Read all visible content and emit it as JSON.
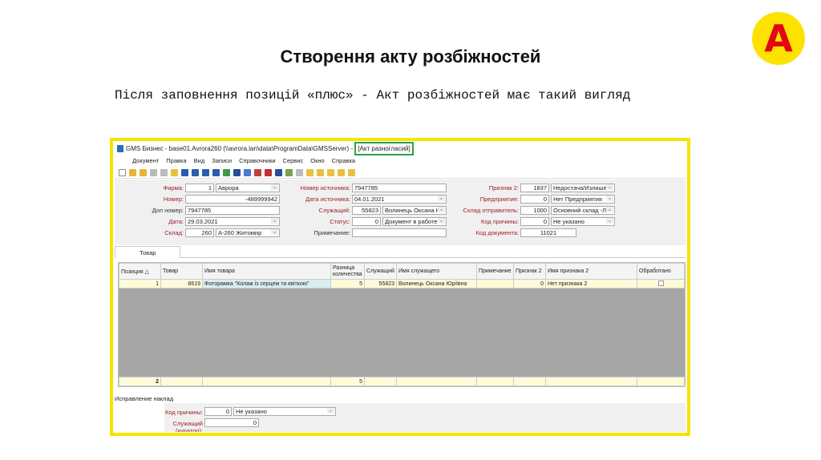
{
  "logo": "A",
  "slide": {
    "title": "Створення акту розбіжностей",
    "description": "Після заповнення позицій «плюс» - Акт розбіжностей має такий вигляд"
  },
  "window": {
    "title": "GMS Бизнес - base01.Avrora260 (\\\\avrora.lan\\data\\ProgramData\\GMSServer)",
    "title_highlight": "[Акт разногласий]",
    "menu": [
      "Документ",
      "Правка",
      "Вид",
      "Записи",
      "Справочники",
      "Сервис",
      "Окно",
      "Справка"
    ]
  },
  "form": {
    "firma": {
      "label": "Фирма:",
      "code": "1",
      "value": "Аврора"
    },
    "nomer": {
      "label": "Номер:",
      "value": "-489999942"
    },
    "dop_nomer": {
      "label": "Доп номер:",
      "value": "7947785"
    },
    "data": {
      "label": "Дата:",
      "value": "29.03.2021"
    },
    "sklad": {
      "label": "Склад:",
      "code": "260",
      "value": "А-260 Житомир"
    },
    "nomer_ist": {
      "label": "Номер источника:",
      "value": "7947785"
    },
    "data_ist": {
      "label": "Дата источника:",
      "value": "04.01.2021"
    },
    "sluzh": {
      "label": "Служащий:",
      "code": "55823",
      "value": "Волинець Оксана Ю"
    },
    "status": {
      "label": "Статус:",
      "code": "0",
      "value": "Документ в работе"
    },
    "prim": {
      "label": "Примечание:",
      "value": ""
    },
    "priznak2": {
      "label": "Признак 2:",
      "code": "1837",
      "value": "Недостача/Излишек"
    },
    "predpr": {
      "label": "Предприятие:",
      "code": "0",
      "value": "Нет Предприятия"
    },
    "sklad_otpr": {
      "label": "Склад отправитель:",
      "code": "1000",
      "value": "Основний склад -Л"
    },
    "kod_prich": {
      "label": "Код причины:",
      "code": "0",
      "value": "Не указано"
    },
    "kod_doc": {
      "label": "Код документа:",
      "value": "11021"
    }
  },
  "tab": "Товар",
  "grid": {
    "columns": [
      "Позиция △",
      "Товар",
      "Имя товара",
      "Разница количества",
      "Служащий",
      "Имя служащего",
      "Примечание",
      "Признак 2",
      "Имя признака 2",
      "Обработано"
    ],
    "rows": [
      [
        "1",
        "8619",
        "Фоторамка \"Колаж із серцем та квіткою\"",
        "5",
        "55823",
        "Волинець Оксана Юріївна",
        "",
        "0",
        "Нет признака 2",
        ""
      ]
    ],
    "footer": {
      "count": "2",
      "sum": "5"
    }
  },
  "bottom": {
    "tab": "Исправление наклад",
    "kod_prich": {
      "label": "Код причины:",
      "code": "0",
      "value": "Не указано"
    },
    "kurator": {
      "label": "Служащий (куратор):",
      "value": "0"
    }
  }
}
